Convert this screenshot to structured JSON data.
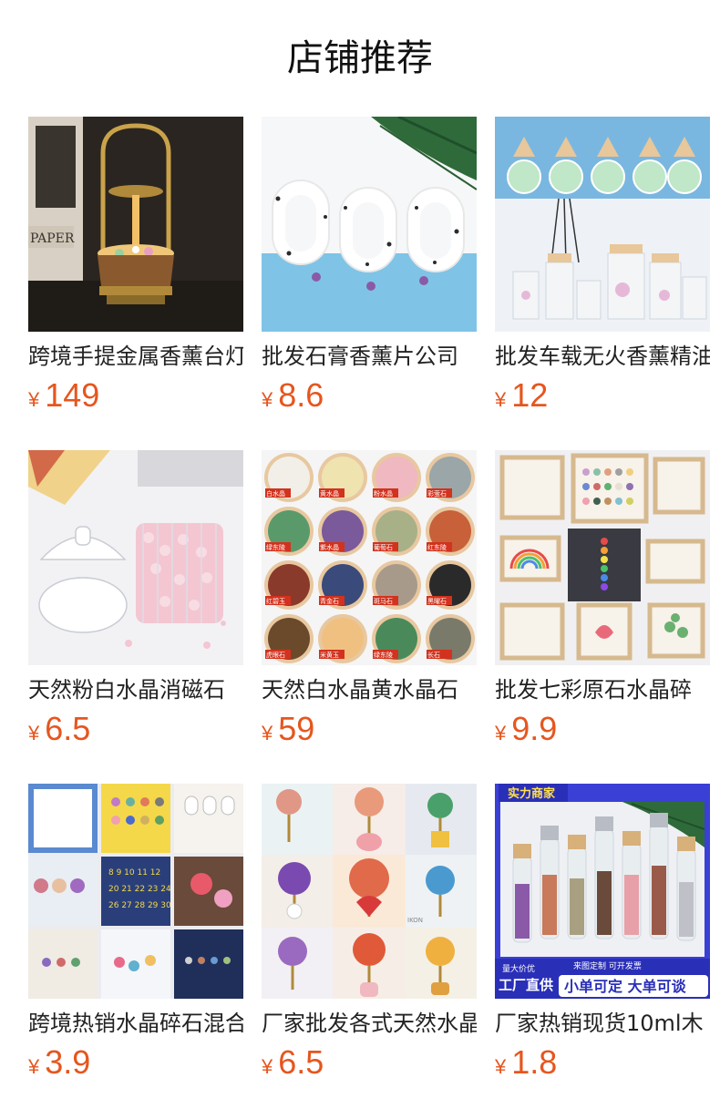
{
  "header": {
    "title": "店铺推荐"
  },
  "products": [
    {
      "title": "跨境手提金属香薰台灯",
      "currency": "¥",
      "price": "149",
      "image": "lamp-image"
    },
    {
      "title": "批发石膏香薰片公司",
      "currency": "¥",
      "price": "8.6",
      "image": "plaster-image"
    },
    {
      "title": "批发车载无火香薰精油",
      "currency": "¥",
      "price": "12",
      "image": "diffuser-image"
    },
    {
      "title": "天然粉白水晶消磁石",
      "currency": "¥",
      "price": "6.5",
      "image": "crystal-jar-image"
    },
    {
      "title": "天然白水晶黄水晶石",
      "currency": "¥",
      "price": "59",
      "image": "gravel-image"
    },
    {
      "title": "批发七彩原石水晶碎",
      "currency": "¥",
      "price": "9.9",
      "image": "frames-image"
    },
    {
      "title": "跨境热销水晶碎石混合",
      "currency": "¥",
      "price": "3.9",
      "image": "boxes-image"
    },
    {
      "title": "厂家批发各式天然水晶",
      "currency": "¥",
      "price": "6.5",
      "image": "tree-image"
    },
    {
      "title": "厂家热销现货10ml木",
      "currency": "¥",
      "price": "1.8",
      "image": "roller-image",
      "banner": {
        "top": "实力商家",
        "bottom_small_left": "量大价优",
        "bottom_left": "工厂直供",
        "bottom_small_right": "来图定制 可开发票",
        "bottom_right": "小单可定 大单可谈"
      }
    }
  ],
  "gravel_labels": [
    "白水晶",
    "黄水晶",
    "粉水晶",
    "彩萤石",
    "绿东陵",
    "紫水晶",
    "葡萄石",
    "红东陵",
    "红碧玉",
    "青金石",
    "斑马石",
    "黑曜石",
    "虎眼石",
    "米黄玉",
    "绿东陵",
    "长石"
  ],
  "colors": {
    "price": "#e6561e",
    "banner_blue": "#3a3fd6",
    "banner_yellow": "#ffe14a"
  }
}
